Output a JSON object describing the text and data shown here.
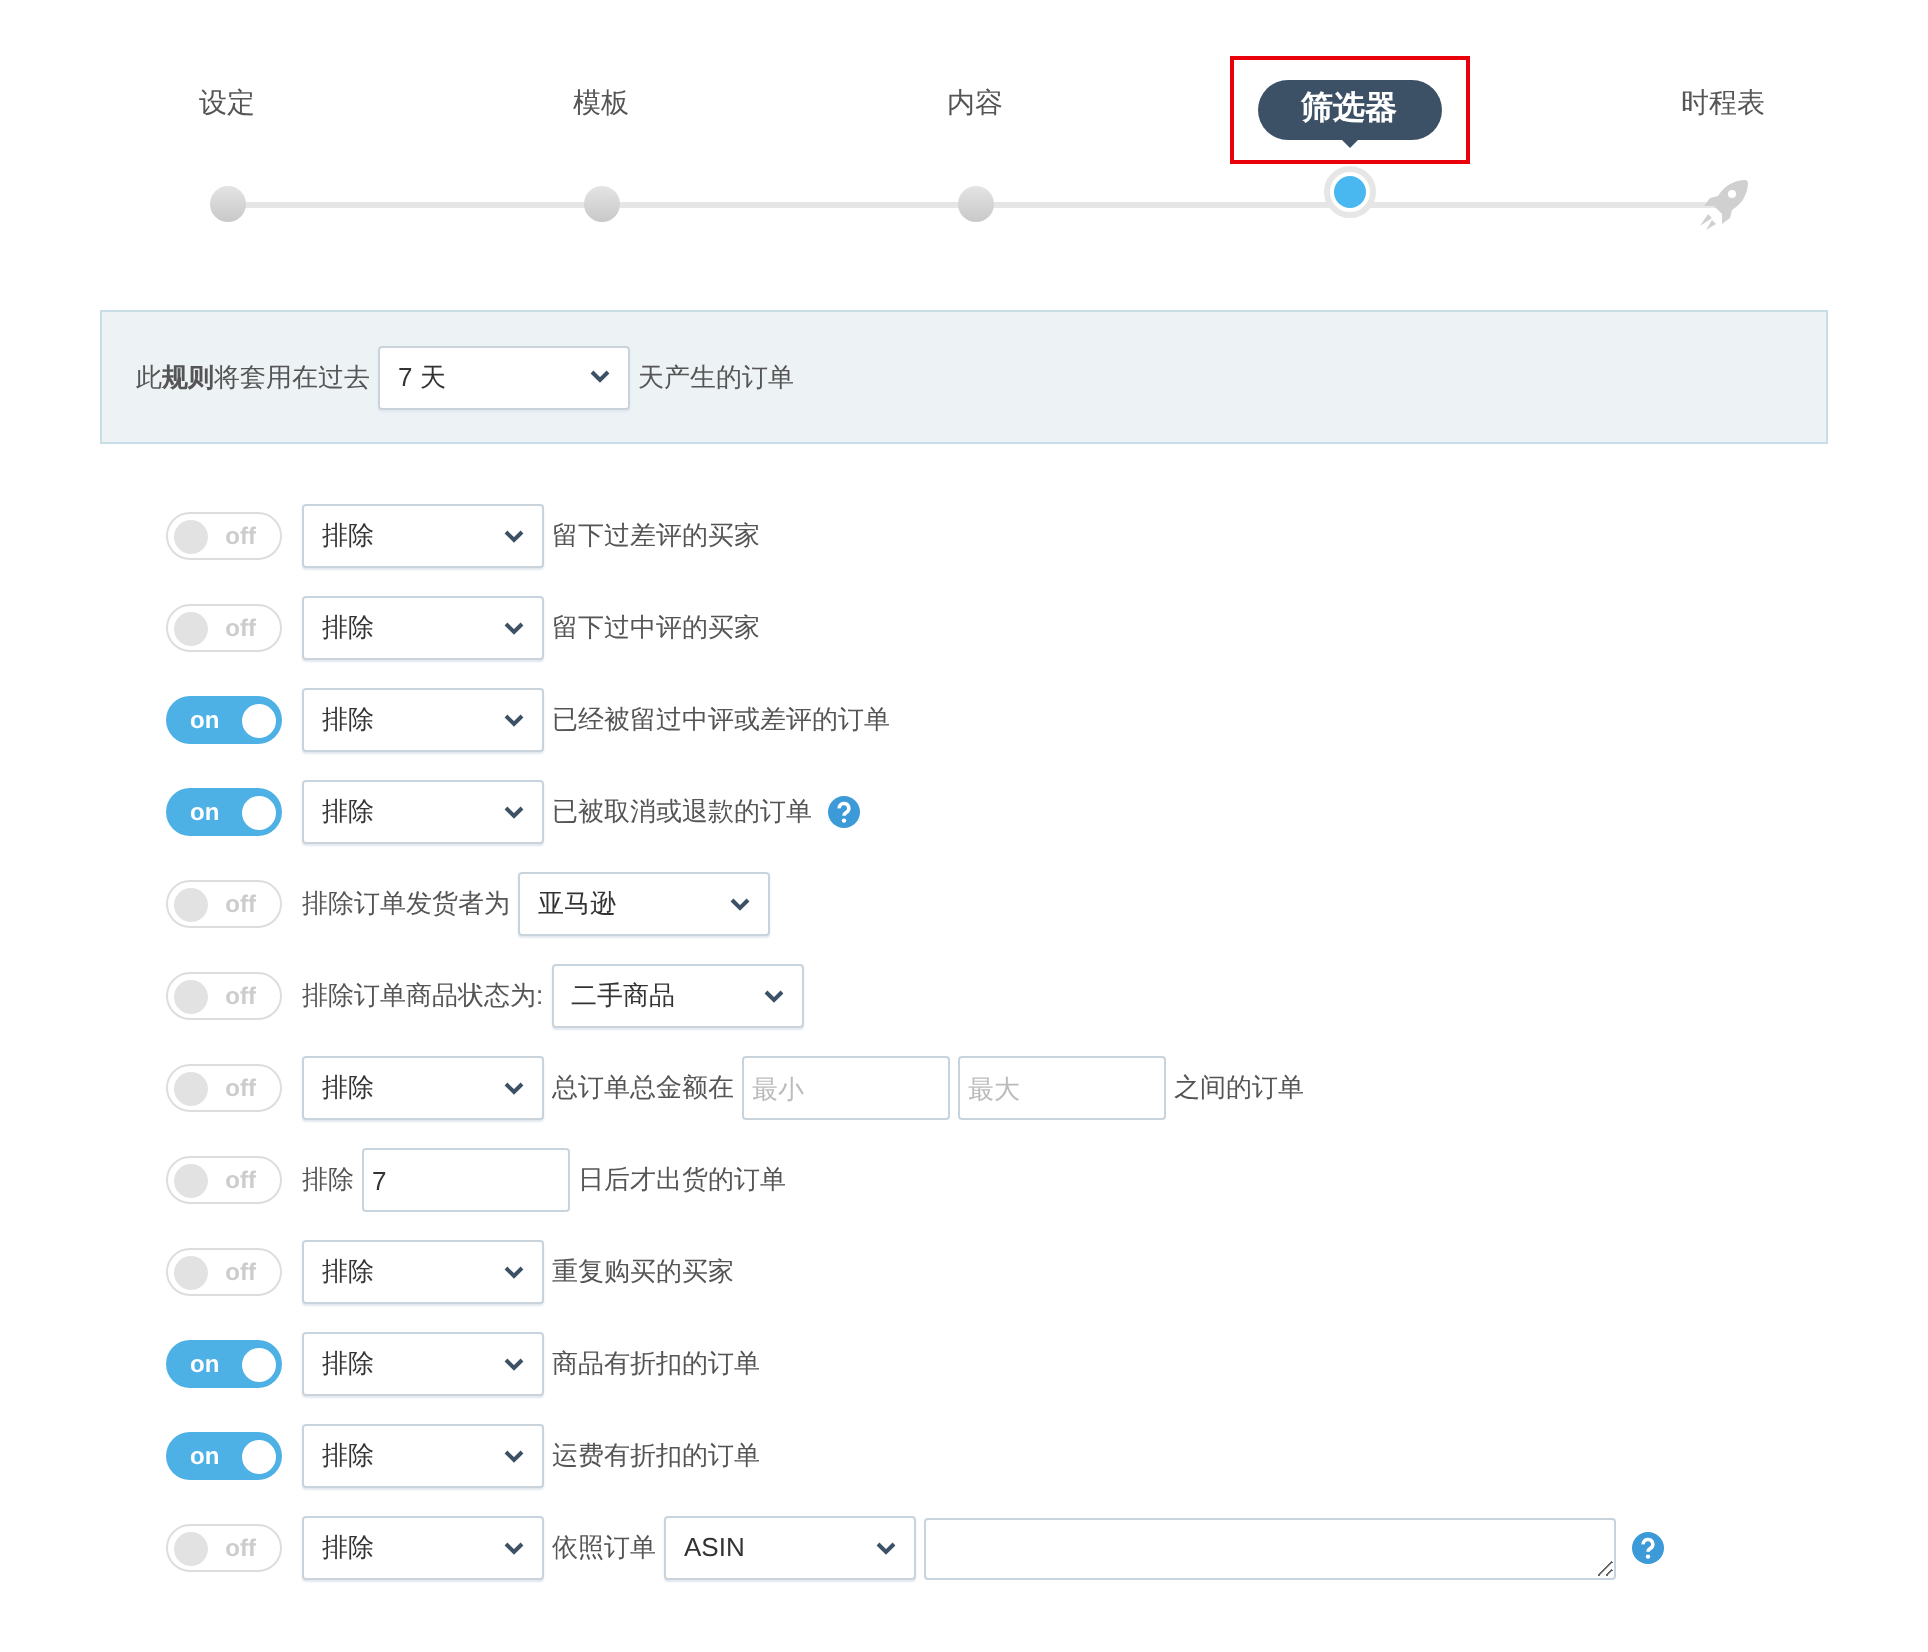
{
  "steps": [
    {
      "label": "设定",
      "kind": "dot",
      "selected": false,
      "highlighted": false
    },
    {
      "label": "模板",
      "kind": "dot",
      "selected": false,
      "highlighted": false
    },
    {
      "label": "内容",
      "kind": "dot",
      "selected": false,
      "highlighted": false
    },
    {
      "label": "筛选器",
      "kind": "dot",
      "selected": true,
      "highlighted": true
    },
    {
      "label": "时程表",
      "kind": "rocket",
      "selected": false,
      "highlighted": false
    }
  ],
  "rule_banner": {
    "text": "此**规则**将套用在过去",
    "select": "7 天",
    "suffix": "天产生的订单"
  },
  "filters": [
    {
      "on": false,
      "switch_label": "off",
      "parts": [
        {
          "kind": "select",
          "value": "排除"
        },
        {
          "kind": "text",
          "text": "留下过差评的买家"
        }
      ]
    },
    {
      "on": false,
      "switch_label": "off",
      "parts": [
        {
          "kind": "select",
          "value": "排除"
        },
        {
          "kind": "text",
          "text": "留下过中评的买家"
        }
      ]
    },
    {
      "on": true,
      "switch_label": "on",
      "parts": [
        {
          "kind": "select",
          "value": "排除"
        },
        {
          "kind": "text",
          "text": "已经被留过中评或差评的订单"
        }
      ]
    },
    {
      "on": true,
      "switch_label": "on",
      "parts": [
        {
          "kind": "select",
          "value": "排除"
        },
        {
          "kind": "text",
          "text": "已被取消或退款的订单"
        },
        {
          "kind": "help"
        }
      ]
    },
    {
      "on": false,
      "switch_label": "off",
      "parts": [
        {
          "kind": "text",
          "text": "排除订单发货者为"
        },
        {
          "kind": "select",
          "value": "亚马逊"
        }
      ]
    },
    {
      "on": false,
      "switch_label": "off",
      "parts": [
        {
          "kind": "text",
          "text": "排除订单商品状态为:"
        },
        {
          "kind": "select",
          "value": "二手商品"
        }
      ]
    },
    {
      "on": false,
      "switch_label": "off",
      "parts": [
        {
          "kind": "select",
          "value": "排除"
        },
        {
          "kind": "text",
          "text": "总订单总金额在"
        },
        {
          "kind": "input",
          "placeholder": "最小"
        },
        {
          "kind": "input",
          "placeholder": "最大"
        },
        {
          "kind": "text",
          "text": "之间的订单"
        }
      ]
    },
    {
      "on": false,
      "switch_label": "off",
      "parts": [
        {
          "kind": "text",
          "text": "排除"
        },
        {
          "kind": "input",
          "value": "7"
        },
        {
          "kind": "text",
          "text": "日后才出货的订单"
        }
      ]
    },
    {
      "on": false,
      "switch_label": "off",
      "parts": [
        {
          "kind": "select",
          "value": "排除"
        },
        {
          "kind": "text",
          "text": "重复购买的买家"
        }
      ]
    },
    {
      "on": true,
      "switch_label": "on",
      "parts": [
        {
          "kind": "select",
          "value": "排除"
        },
        {
          "kind": "text",
          "text": "商品有折扣的订单"
        }
      ]
    },
    {
      "on": true,
      "switch_label": "on",
      "parts": [
        {
          "kind": "select",
          "value": "排除"
        },
        {
          "kind": "text",
          "text": "运费有折扣的订单"
        }
      ]
    },
    {
      "on": false,
      "switch_label": "off",
      "parts": [
        {
          "kind": "select",
          "value": "排除"
        },
        {
          "kind": "text",
          "text": "依照订单"
        },
        {
          "kind": "select",
          "value": "ASIN"
        },
        {
          "kind": "textarea"
        },
        {
          "kind": "help"
        }
      ]
    }
  ]
}
